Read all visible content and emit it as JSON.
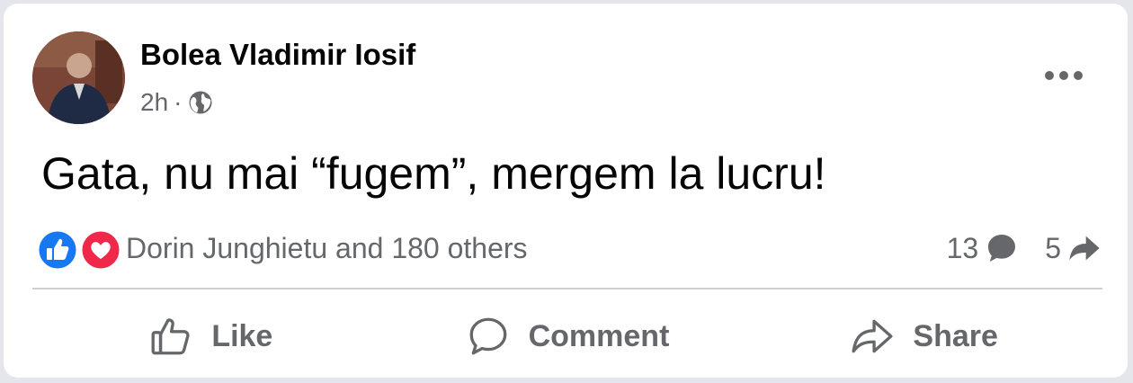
{
  "post": {
    "author": "Bolea Vladimir Iosif",
    "time": "2h",
    "separator": "·",
    "audience_icon": "globe-icon",
    "more_icon": "more-options-icon",
    "text": "Gata, nu mai “fugem”, mergem la lucru!"
  },
  "reactions": {
    "types": [
      "like-reaction-icon",
      "love-reaction-icon"
    ],
    "summary": "Dorin Junghietu and 180 others",
    "comments_count": "13",
    "shares_count": "5"
  },
  "actions": {
    "like_label": "Like",
    "comment_label": "Comment",
    "share_label": "Share"
  },
  "colors": {
    "like_blue": "#1877f2",
    "love_red": "#f02849",
    "secondary_text": "#65676b",
    "primary_text": "#050505"
  }
}
